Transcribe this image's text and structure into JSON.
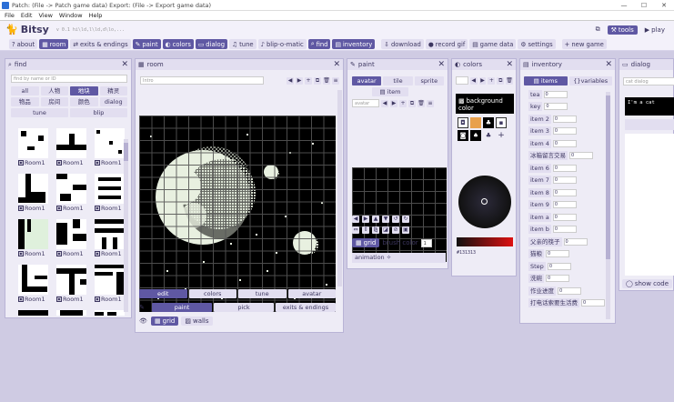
{
  "window": {
    "title": "Patch: (File -> Patch game data)   Export: (File -> Export game data)",
    "controls": [
      "—",
      "☐",
      "✕"
    ]
  },
  "menu": [
    "File",
    "Edit",
    "View",
    "Window",
    "Help"
  ],
  "app": {
    "logo": "Bitsy",
    "version": "v 0.1 hi\\ld,l\\ld,d\\lo,...",
    "tools_label": "tools",
    "play_label": "play"
  },
  "toolbar": [
    {
      "label": "about",
      "icon": "?",
      "on": false
    },
    {
      "label": "room",
      "icon": "▦",
      "on": true
    },
    {
      "label": "exits & endings",
      "icon": "⇄",
      "on": false
    },
    {
      "label": "paint",
      "icon": "✎",
      "on": true
    },
    {
      "label": "colors",
      "icon": "◐",
      "on": true
    },
    {
      "label": "dialog",
      "icon": "▭",
      "on": true
    },
    {
      "label": "tune",
      "icon": "♫",
      "on": false
    },
    {
      "label": "blip-o-matic",
      "icon": "♪",
      "on": false
    },
    {
      "label": "find",
      "icon": "⌕",
      "on": true
    },
    {
      "label": "inventory",
      "icon": "▤",
      "on": true
    },
    {
      "label": "download",
      "icon": "⇩",
      "on": false
    },
    {
      "label": "record gif",
      "icon": "●",
      "on": false
    },
    {
      "label": "game data",
      "icon": "▤",
      "on": false
    },
    {
      "label": "settings",
      "icon": "⚙",
      "on": false
    },
    {
      "label": "new game",
      "icon": "+",
      "on": false
    }
  ],
  "find": {
    "title": "find",
    "search_placeholder": "find by name or ID",
    "cats1": [
      {
        "label": "all",
        "on": false
      },
      {
        "label": "人物",
        "on": false
      },
      {
        "label": "地块",
        "on": true
      },
      {
        "label": "精灵",
        "on": false
      }
    ],
    "cats2": [
      {
        "label": "物品",
        "on": false
      },
      {
        "label": "房间",
        "on": false
      },
      {
        "label": "颜色",
        "on": false
      },
      {
        "label": "dialog",
        "on": false
      }
    ],
    "cats3": [
      {
        "label": "tune",
        "on": false
      },
      {
        "label": "blip",
        "on": false
      }
    ],
    "item_label": "Room1"
  },
  "room": {
    "title": "room",
    "name_placeholder": "Intro",
    "tabs1": [
      {
        "label": "edit",
        "on": true
      },
      {
        "label": "colors",
        "on": false
      },
      {
        "label": "tune",
        "on": false
      },
      {
        "label": "avatar",
        "on": false
      }
    ],
    "tabs2": [
      {
        "label": "paint",
        "on": true
      },
      {
        "label": "pick",
        "on": false
      },
      {
        "label": "exits & endings",
        "on": false
      }
    ],
    "grid_label": "grid",
    "walls_label": "walls"
  },
  "paint": {
    "title": "paint",
    "tabs1": [
      {
        "label": "avatar",
        "on": true
      },
      {
        "label": "tile",
        "on": false
      },
      {
        "label": "sprite",
        "on": false
      }
    ],
    "tab_item": "item",
    "name_placeholder": "avatar",
    "grid_label": "grid",
    "brush_label": "brush color",
    "brush_value": "1",
    "animation_label": "animation"
  },
  "colors": {
    "title": "colors",
    "bg_label": "background color",
    "hex": "#131313"
  },
  "inventory": {
    "title": "inventory",
    "tab_items": "items",
    "tab_vars": "variables",
    "rows": [
      {
        "name": "tea",
        "value": "0"
      },
      {
        "name": "key",
        "value": "0"
      },
      {
        "name": "item 2",
        "value": "0"
      },
      {
        "name": "item 3",
        "value": "0"
      },
      {
        "name": "item 4",
        "value": "0"
      },
      {
        "name": "冰箱留言交易",
        "value": "0"
      },
      {
        "name": "item 6",
        "value": "0"
      },
      {
        "name": "item 7",
        "value": "0"
      },
      {
        "name": "item 8",
        "value": "0"
      },
      {
        "name": "item 9",
        "value": "0"
      },
      {
        "name": "item a",
        "value": "0"
      },
      {
        "name": "item b",
        "value": "0"
      },
      {
        "name": "父亲的筷子",
        "value": "0"
      },
      {
        "name": "猫粮",
        "value": "0"
      },
      {
        "name": "Step",
        "value": "0"
      },
      {
        "name": "洗碗",
        "value": "0"
      },
      {
        "name": "作业进度",
        "value": "0"
      },
      {
        "name": "打电话索要生活费",
        "value": "0"
      }
    ]
  },
  "dialog": {
    "title": "dialog",
    "id_placeholder": "cat dialog",
    "preview_text": "I'm a cat",
    "show_code_label": "show code"
  }
}
